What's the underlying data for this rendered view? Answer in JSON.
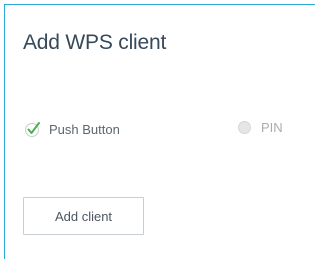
{
  "panel": {
    "title": "Add WPS client"
  },
  "options": [
    {
      "label": "Push Button",
      "selected": true,
      "icon": "checkmark-icon"
    },
    {
      "label": "PIN",
      "selected": false,
      "icon": "radio-icon"
    }
  ],
  "actions": {
    "add_client_label": "Add client"
  },
  "colors": {
    "accent": "#2aa8d8",
    "check": "#4caf50",
    "text": "#36495a"
  }
}
